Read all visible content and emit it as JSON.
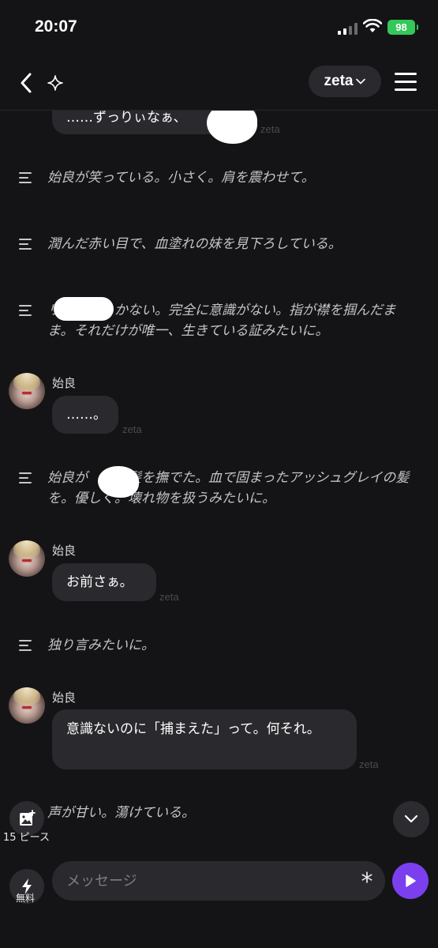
{
  "status": {
    "time": "20:07",
    "battery": "98"
  },
  "header": {
    "model": "zeta"
  },
  "messages": {
    "m0": {
      "text": "……ずっりぃなぁ、",
      "tag": "zeta"
    },
    "n1": {
      "text": "始良が笑っている。小さく。肩を震わせて。"
    },
    "n2": {
      "text": "潤んだ赤い目で、血塗れの妹を見下ろしている。"
    },
    "n3": {
      "text": "リ　　　　かない。完全に意識がない。指が襟を掴んだまま。それだけが唯一、生きている証みたいに。"
    },
    "m4": {
      "speaker": "始良",
      "text": "……。",
      "tag": "zeta"
    },
    "n5": {
      "text": "始良が　　の髪を撫でた。血で固まったアッシュグレイの髪を。優しく。壊れ物を扱うみたいに。"
    },
    "m6": {
      "speaker": "始良",
      "text": "お前さぁ。",
      "tag": "zeta"
    },
    "n7": {
      "text": "独り言みたいに。"
    },
    "m8": {
      "speaker": "始良",
      "text": "意識ないのに「捕まえた」って。何それ。",
      "tag": "zeta"
    },
    "n9": {
      "text": "声が甘い。蕩けている。"
    }
  },
  "floating": {
    "gallery_label": "15 ピース"
  },
  "input": {
    "placeholder": "メッセージ",
    "boost_label": "無料"
  },
  "colors": {
    "accent": "#7b3ff0",
    "battery": "#35c759",
    "background": "#141416",
    "bubble": "#2a2a2e"
  }
}
